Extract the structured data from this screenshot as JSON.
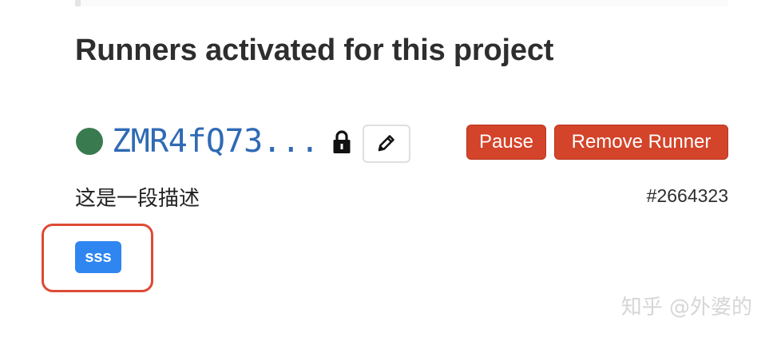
{
  "section": {
    "title": "Runners activated for this project"
  },
  "runner": {
    "status_color": "#3a7a4f",
    "token": "ZMR4fQ73...",
    "lock_icon": "lock-icon",
    "edit_icon": "pencil-icon",
    "description": "这是一段描述",
    "id": "#2664323",
    "tags": [
      "sss"
    ]
  },
  "actions": {
    "pause_label": "Pause",
    "remove_label": "Remove Runner"
  },
  "colors": {
    "danger": "#d3442a",
    "link": "#2f6ab5",
    "tag": "#2f86f0",
    "highlight": "#de4a35"
  },
  "watermark": "知乎 @外婆的"
}
